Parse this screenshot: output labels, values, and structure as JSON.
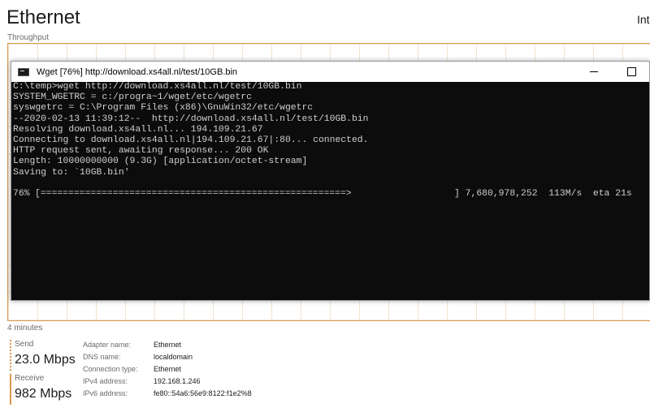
{
  "header": {
    "title": "Ethernet",
    "right_text": "Int",
    "throughput_label": "Throughput",
    "time_label": "4 minutes"
  },
  "metrics": {
    "send": {
      "label": "Send",
      "value": "23.0 Mbps"
    },
    "receive": {
      "label": "Receive",
      "value": "982 Mbps"
    }
  },
  "details": [
    {
      "key": "Adapter name:",
      "value": "Ethernet"
    },
    {
      "key": "DNS name:",
      "value": "localdomain"
    },
    {
      "key": "Connection type:",
      "value": "Ethernet"
    },
    {
      "key": "IPv4 address:",
      "value": "192.168.1.246"
    },
    {
      "key": "IPv6 address:",
      "value": "fe80::54a6:56e9:8122:f1e2%8"
    }
  ],
  "console": {
    "window_title": "Wget [76%] http://download.xs4all.nl/test/10GB.bin",
    "lines": [
      "C:\\temp>wget http://download.xs4all.nl/test/10GB.bin",
      "SYSTEM_WGETRC = c:/progra~1/wget/etc/wgetrc",
      "syswgetrc = C:\\Program Files (x86)\\GnuWin32/etc/wgetrc",
      "--2020-02-13 11:39:12--  http://download.xs4all.nl/test/10GB.bin",
      "Resolving download.xs4all.nl... 194.109.21.67",
      "Connecting to download.xs4all.nl|194.109.21.67|:80... connected.",
      "HTTP request sent, awaiting response... 200 OK",
      "Length: 10000000000 (9.3G) [application/octet-stream]",
      "Saving to: `10GB.bin'"
    ],
    "progress": {
      "percent_text": "76%",
      "bar_text": "[=======================================================>",
      "stats_text": "] 7,680,978,252  113M/s  eta 21s",
      "fraction": 0.76
    }
  },
  "colors": {
    "graph_border": "#d99a4b",
    "console_bg": "#0c0c0c",
    "console_text": "#d0d0d0"
  }
}
